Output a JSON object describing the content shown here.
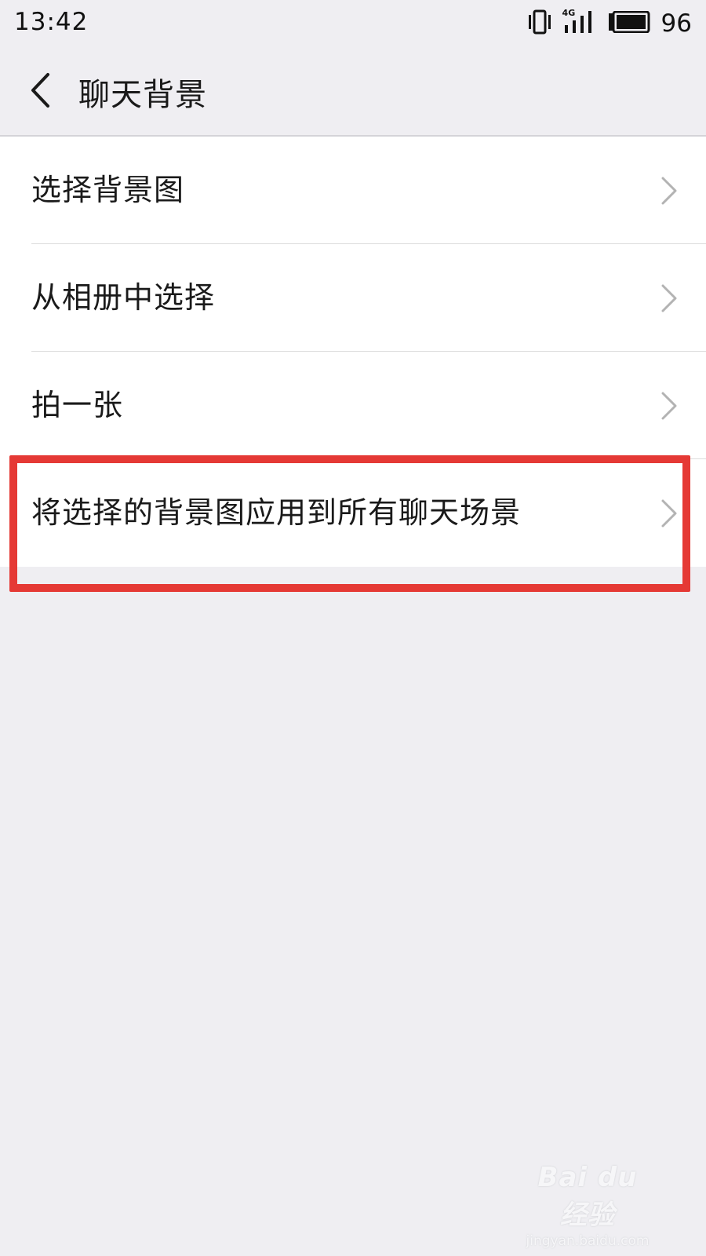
{
  "status_bar": {
    "time": "13:42",
    "network": "4G",
    "battery": "96",
    "icons": [
      "vibrate-icon",
      "signal-icon",
      "battery-icon"
    ]
  },
  "nav": {
    "back_icon": "chevron-left-icon",
    "title": "聊天背景"
  },
  "menu": {
    "items": [
      {
        "label": "选择背景图"
      },
      {
        "label": "从相册中选择"
      },
      {
        "label": "拍一张"
      },
      {
        "label": "将选择的背景图应用到所有聊天场景"
      }
    ],
    "chevron_icon": "chevron-right-icon"
  },
  "highlight": {
    "color": "#e53935"
  },
  "watermark": {
    "logo": "Bai du 经验",
    "url": "jingyan.baidu.com"
  },
  "colors": {
    "background": "#efeef2",
    "list_background": "#ffffff",
    "divider": "#dcdcdc"
  }
}
